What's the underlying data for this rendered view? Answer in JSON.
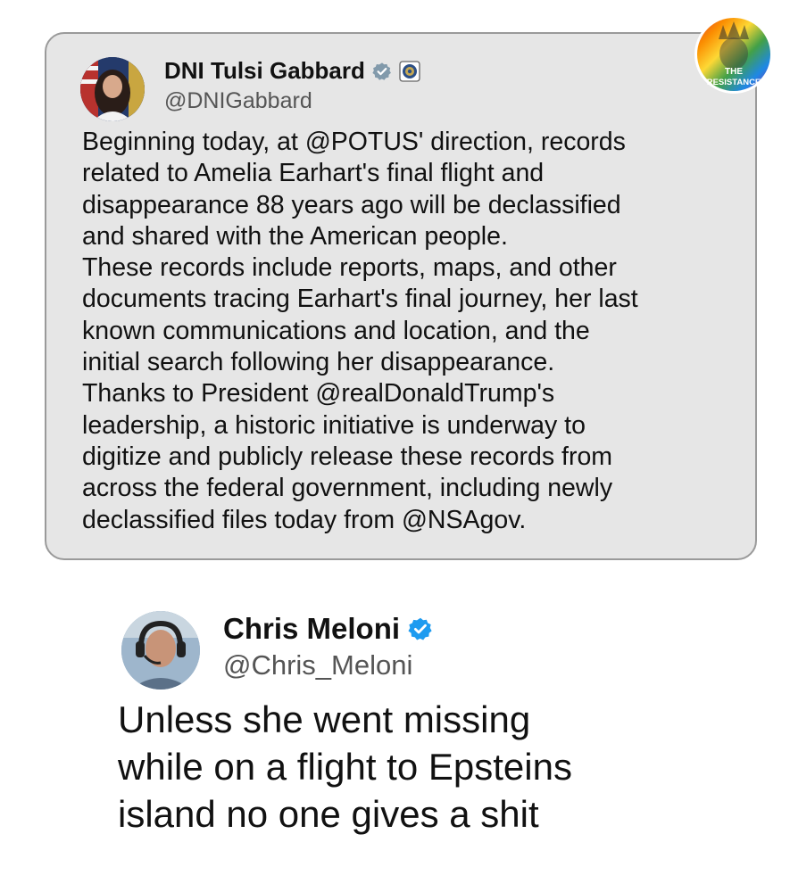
{
  "quoted_tweet": {
    "display_name": "DNI Tulsi Gabbard",
    "handle": "@DNIGabbard",
    "verified_badge": "gray-verified-icon",
    "affiliation_icon": "government-seal-icon",
    "body_lines": [
      "Beginning today, at @POTUS' direction, records",
      "related to Amelia Earhart's final flight and",
      "disappearance 88 years ago will be declassified",
      "and shared with the American people.",
      "These records include reports, maps, and other",
      "documents tracing Earhart's final journey, her last",
      "known communications and location, and the",
      "initial search following her disappearance.",
      "Thanks to President @realDonaldTrump's",
      "leadership, a historic initiative is underway to",
      "digitize and publicly release these records from",
      "across the federal government, including newly",
      "declassified files today from @NSAgov."
    ]
  },
  "reply_tweet": {
    "display_name": "Chris Meloni",
    "handle": "@Chris_Meloni",
    "verified_badge": "blue-verified-icon",
    "body_lines": [
      "Unless she went missing",
      "while on a flight to Epsteins",
      "island no one gives a shit"
    ]
  },
  "badge": {
    "line1": "THE",
    "line2": "RESISTANCE"
  },
  "colors": {
    "card_background": "#e6e6e6",
    "card_border": "#9a9a9a",
    "handle_gray": "#555555",
    "verified_blue": "#1d9bf0",
    "verified_gray": "#829aab"
  }
}
